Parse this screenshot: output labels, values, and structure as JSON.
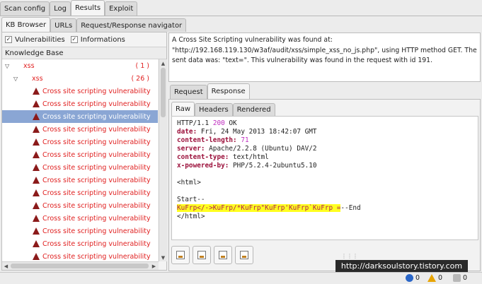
{
  "top_tabs": [
    "Scan config",
    "Log",
    "Results",
    "Exploit"
  ],
  "sub_tabs": [
    "KB Browser",
    "URLs",
    "Request/Response navigator"
  ],
  "filters": {
    "vulnerabilities": "Vulnerabilities",
    "informations": "Informations"
  },
  "kb_header": "Knowledge Base",
  "tree": {
    "root": {
      "label": "xss",
      "count": "( 1 )"
    },
    "child": {
      "label": "xss",
      "count": "( 26 )"
    },
    "items": [
      "Cross site scripting vulnerability",
      "Cross site scripting vulnerability",
      "Cross site scripting vulnerability",
      "Cross site scripting vulnerability",
      "Cross site scripting vulnerability",
      "Cross site scripting vulnerability",
      "Cross site scripting vulnerability",
      "Cross site scripting vulnerability",
      "Cross site scripting vulnerability",
      "Cross site scripting vulnerability",
      "Cross site scripting vulnerability",
      "Cross site scripting vulnerability",
      "Cross site scripting vulnerability",
      "Cross site scripting vulnerability"
    ],
    "selected_index": 2
  },
  "description": "A Cross Site Scripting vulnerability was found at: \"http://192.168.119.130/w3af/audit/xss/simple_xss_no_js.php\", using HTTP method GET. The sent data was: \"text=\". This vulnerability was found in the request with id 191.",
  "rr_tabs": [
    "Request",
    "Response"
  ],
  "view_tabs": [
    "Raw",
    "Headers",
    "Rendered"
  ],
  "response": {
    "status_prefix": "HTTP/1.1 ",
    "status_code": "200",
    "status_suffix": " OK",
    "headers": [
      {
        "name": "date:",
        "value": " Fri, 24 May 2013 18:42:07 GMT"
      },
      {
        "name": "content-length:",
        "value": " 71"
      },
      {
        "name": "server:",
        "value": " Apache/2.2.8 (Ubuntu) DAV/2"
      },
      {
        "name": "content-type:",
        "value": " text/html"
      },
      {
        "name": "x-powered-by:",
        "value": " PHP/5.2.4-2ubuntu5.10"
      }
    ],
    "html_open": "<html>",
    "start": "Start--",
    "payload": "KuFrp</->KuFrp/*KuFrp\"KuFrp'KuFrp`KuFrp =",
    "end": "--End",
    "html_close": "</html>"
  },
  "watermark": "http://darksoulstory.tistory.com",
  "status": {
    "info": "0",
    "warnings": "0",
    "vulns": "0"
  }
}
